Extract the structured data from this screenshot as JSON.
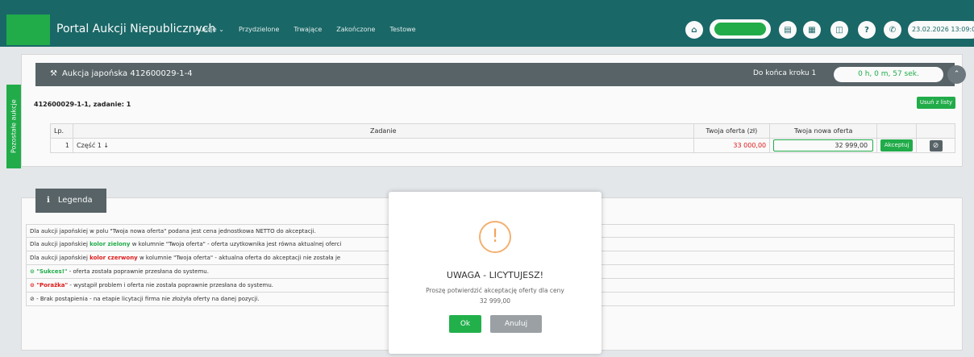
{
  "nav": {
    "brand": "Portal Aukcji Niepublicznych",
    "menu": [
      "Aukcje ⌄",
      "Przydzielone",
      "Trwające",
      "Zakończone",
      "Testowe"
    ],
    "icons": [
      "home-icon",
      "document-icon",
      "printer-icon",
      "book-icon",
      "help-icon",
      "phone-icon"
    ],
    "datetime": "23.02.2026 13:09:0"
  },
  "side_tab": "Pozostałe aukcje",
  "panel": {
    "title": "Aukcja japońska 412600029-1-4",
    "time_left_label": "Do końca kroku 1",
    "timer": "0 h, 0 m, 57 sek.",
    "task_title": "412600029-1-1, zadanie: 1",
    "remove_label": "Usuń z listy",
    "table": {
      "headers": [
        "Lp.",
        "Zadanie",
        "Twoja oferta (zł)",
        "Twoja nowa oferta",
        "",
        ""
      ],
      "row": {
        "lp": "1",
        "task": "Część 1 ↓",
        "offer": "33 000,00",
        "new_offer": "32 999,00",
        "accept": "Akceptuj",
        "reject_icon": "⊘"
      }
    }
  },
  "legend": {
    "title": "Legenda",
    "items": [
      {
        "pre": "Dla aukcji japońskiej w polu \"Twoja nowa oferta\" podana jest cena jednostkowa NETTO do akceptacji.",
        "hl": "",
        "post": ""
      },
      {
        "pre": "Dla aukcji japońskiej ",
        "hl": "kolor zielony",
        "post": " w kolumnie \"Twoja oferta\" - oferta uzytkownika jest równa aktualnej oferci"
      },
      {
        "pre": "Dla aukcji japońskiej ",
        "hl": "kolor czerwony",
        "post": " w kolumnie \"Twoja oferta\" - aktualna oferta do akceptacji nie została je"
      },
      {
        "pre": "⊙ ",
        "hl": "\"Sukces!\"",
        "post": " - oferta została poprawnie przesłana do systemu."
      },
      {
        "pre": "⊙ ",
        "hl": "\"Porażka\"",
        "post": " - wystąpił problem i oferta nie została poprawnie przesłana do systemu."
      },
      {
        "pre": "⊘ - Brak postąpienia - na etapie licytacji firma nie złożyła oferty na danej pozycji.",
        "hl": "",
        "post": ""
      }
    ]
  },
  "modal": {
    "icon": "!",
    "title": "UWAGA - LICYTUJESZ!",
    "message": "Proszę potwierdzić akceptację oferty dla ceny",
    "value": "32 999,00",
    "ok": "Ok",
    "cancel": "Anuluj"
  }
}
